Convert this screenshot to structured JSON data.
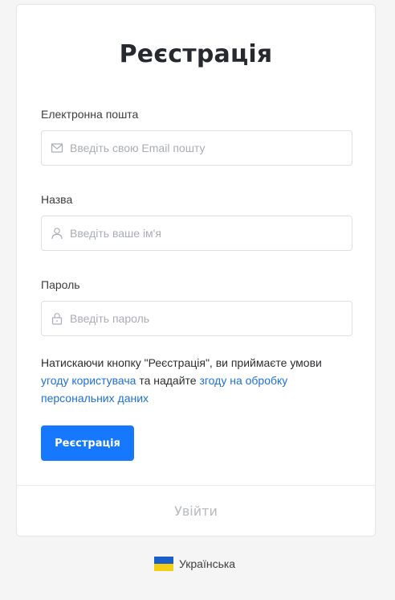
{
  "form": {
    "title": "Реєстрація",
    "email": {
      "label": "Електронна пошта",
      "placeholder": "Введіть свою Email пошту",
      "value": "",
      "icon": "envelope-icon"
    },
    "name": {
      "label": "Назва",
      "placeholder": "Введіть ваше ім'я",
      "value": "",
      "icon": "user-icon"
    },
    "password": {
      "label": "Пароль",
      "placeholder": "Введіть пароль",
      "value": "",
      "icon": "lock-icon"
    },
    "consent": {
      "prefix": "Натискаючи кнопку \"Реєстрація\", ви приймаєте умови",
      "terms_link": "угоду користувача",
      "middle": "та надайте",
      "privacy_link": "згоду на обробку персональних даних"
    },
    "submit_label": "Реєстрація",
    "login_label": "Увійти"
  },
  "language": {
    "label": "Українська",
    "flag_icon": "ukraine-flag-icon"
  },
  "colors": {
    "primary": "#1677ff",
    "link": "#1e6fd9",
    "background": "#f5f5f5",
    "muted": "#b7babe",
    "flag_blue": "#1a5ec9",
    "flag_yellow": "#f5cf12"
  }
}
